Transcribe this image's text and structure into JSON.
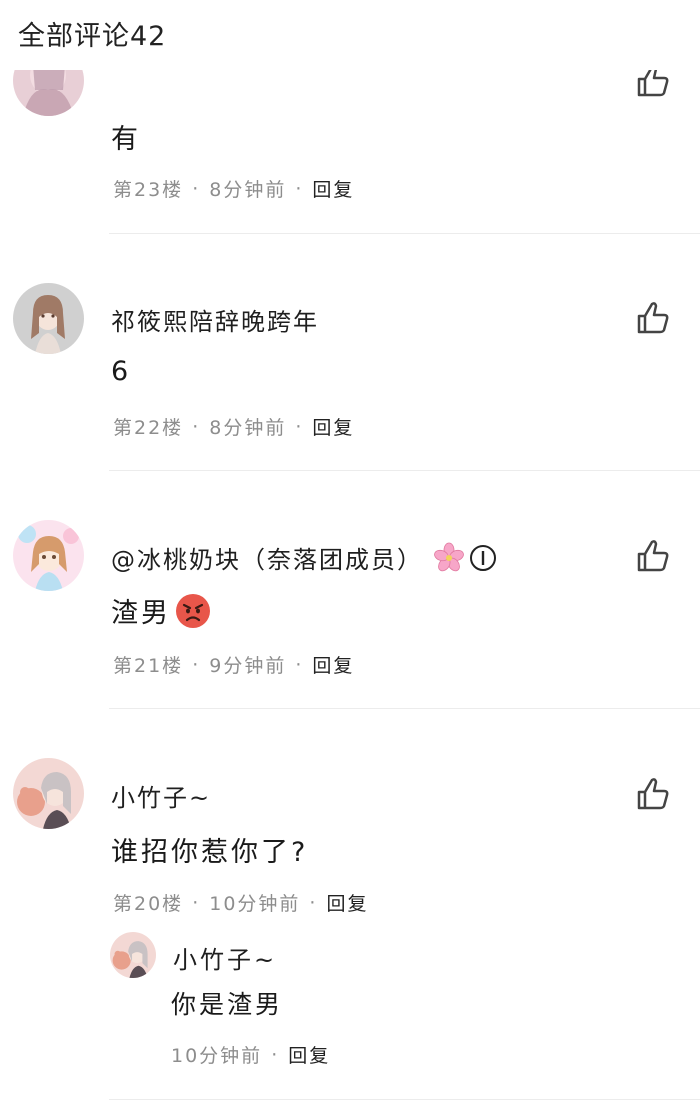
{
  "header": {
    "title": "全部评论42"
  },
  "comments": [
    {
      "floor_text": "第23楼",
      "time": "8分钟前",
      "reply_label": "回复",
      "content": "有"
    },
    {
      "username": "祁筱熙陪辞晚跨年",
      "content": "6",
      "floor_text": "第22楼",
      "time": "8分钟前",
      "reply_label": "回复"
    },
    {
      "username": "@冰桃奶块（奈落团成员）",
      "content": "渣男",
      "floor_text": "第21楼",
      "time": "9分钟前",
      "reply_label": "回复",
      "badges": [
        "sakura-icon",
        "level-1-badge"
      ]
    },
    {
      "username": "小竹子~",
      "content": "谁招你惹你了?",
      "floor_text": "第20楼",
      "time": "10分钟前",
      "reply_label": "回复",
      "sub_reply": {
        "username": "小竹子~",
        "content": "你是渣男",
        "time": "10分钟前",
        "reply_label": "回复"
      }
    }
  ],
  "colors": {
    "meta_gray": "#8d8d8d",
    "divider": "#ececec",
    "text": "#1a1a1a"
  }
}
